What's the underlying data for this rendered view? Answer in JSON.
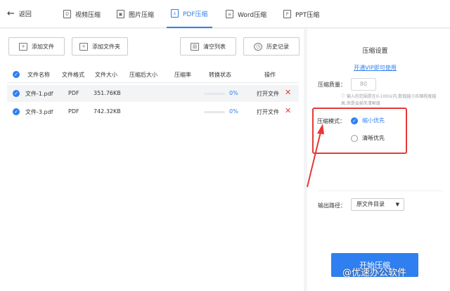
{
  "header": {
    "back_label": "返回",
    "tabs": [
      {
        "label": "视频压缩",
        "icon": "video-icon",
        "glyph": "D"
      },
      {
        "label": "图片压缩",
        "icon": "image-icon",
        "glyph": "▣"
      },
      {
        "label": "PDF压缩",
        "icon": "pdf-icon",
        "glyph": "⅄",
        "active": true
      },
      {
        "label": "Word压缩",
        "icon": "word-icon",
        "glyph": "≡"
      },
      {
        "label": "PPT压缩",
        "icon": "ppt-icon",
        "glyph": "P"
      }
    ]
  },
  "toolbar": {
    "add_file": "添加文件",
    "add_folder": "添加文件夹",
    "clear_list": "清空列表",
    "history": "历史记录"
  },
  "table": {
    "columns": [
      "文件名称",
      "文件格式",
      "文件大小",
      "压缩后大小",
      "压缩率",
      "转换状态",
      "操作"
    ],
    "rows": [
      {
        "name": "文件-1.pdf",
        "format": "PDF",
        "size": "351.76KB",
        "progress": "0%",
        "action": "打开文件"
      },
      {
        "name": "文件-3.pdf",
        "format": "PDF",
        "size": "742.32KB",
        "progress": "0%",
        "action": "打开文件"
      }
    ]
  },
  "settings": {
    "title": "压缩设置",
    "vip_link": "开通VIP即可使用",
    "quality_label": "压缩质量：",
    "quality_value": "80",
    "hint": "输入的范围是在0-100以内,数值越小压缩程度越高,但是会损失清晰度",
    "mode_label": "压缩模式：",
    "mode_options": [
      "缩小优先",
      "清晰优先"
    ],
    "output_label": "输出路径：",
    "output_value": "原文件目录",
    "start_button": "开始压缩"
  },
  "watermark": "@优速办公软件",
  "colors": {
    "accent": "#2f7ff0",
    "highlight": "#e53935"
  }
}
